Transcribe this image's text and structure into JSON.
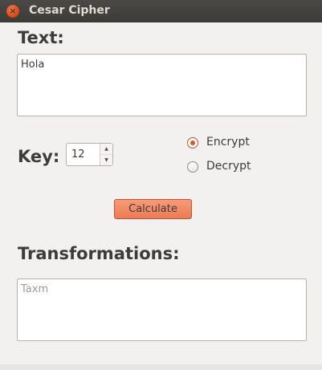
{
  "window": {
    "title": "Cesar Cipher",
    "close_symbol": "×",
    "close_icon": "close-icon"
  },
  "labels": {
    "text": "Text:",
    "key": "Key:",
    "transformations": "Transformations:"
  },
  "input": {
    "value": "Hola"
  },
  "key_spinner": {
    "value": "12",
    "up_symbol": "▲",
    "down_symbol": "▼"
  },
  "mode": {
    "options": [
      "Encrypt",
      "Decrypt"
    ],
    "selected": "Encrypt",
    "accent_color": "#e0562a"
  },
  "calculate_button": {
    "label": "Calculate",
    "color": "#f08a66"
  },
  "output": {
    "value": "Taxm"
  }
}
